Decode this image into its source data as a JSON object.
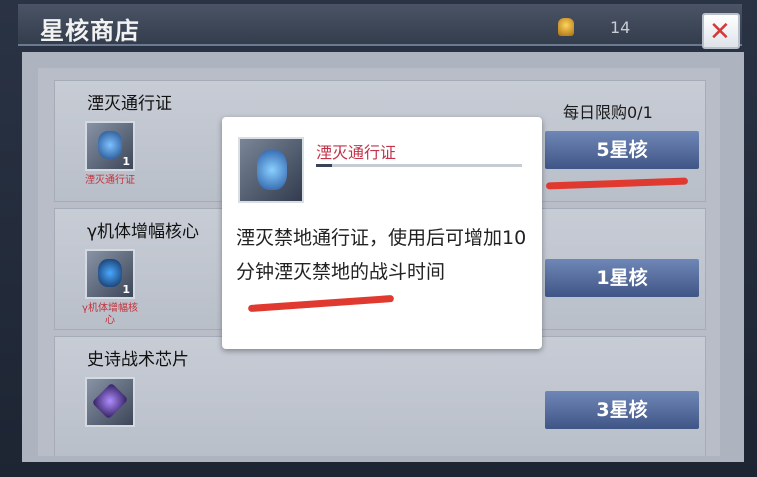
{
  "header": {
    "title": "星核商店",
    "currency_icon": "gold-badge-icon",
    "currency_count": "14",
    "close_label": "✕"
  },
  "items": [
    {
      "name": "湮灭通行证",
      "icon_label": "湮灭通行证",
      "icon_count": "1",
      "limit": "每日限购0/1",
      "price_label": "5星核"
    },
    {
      "name": "γ机体增幅核心",
      "icon_label": "γ机体增幅核心",
      "icon_count": "1",
      "limit": "",
      "price_label": "1星核"
    },
    {
      "name": "史诗战术芯片",
      "icon_label": "",
      "icon_count": "",
      "limit": "",
      "price_label": "3星核"
    }
  ],
  "popup": {
    "name": "湮灭通行证",
    "description": "湮灭禁地通行证，使用后可增加10分钟湮灭禁地的战斗时间"
  },
  "colors": {
    "accent_red": "#e0392f",
    "button_blue": "#4d6396",
    "popup_title": "#c2334a"
  }
}
